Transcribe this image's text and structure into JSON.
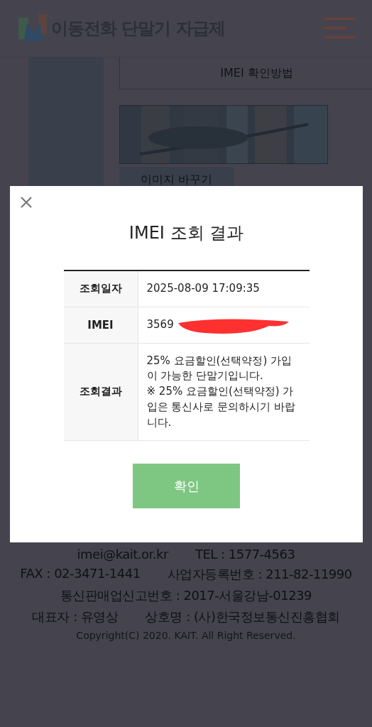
{
  "header": {
    "title": "이동전화 단말기 자급제"
  },
  "tab": {
    "label": "IMEI 확인방법"
  },
  "captcha": {
    "kind": "picture",
    "refresh_button": "이미지 바꾸기"
  },
  "modal": {
    "title": "IMEI 조회 결과",
    "rows": [
      {
        "label": "조회일자",
        "value": "2025-08-09 17:09:35",
        "redacted": false
      },
      {
        "label": "IMEI",
        "value": "3569",
        "redacted": true
      },
      {
        "label": "조회결과",
        "value": "25% 요금할인(선택약정) 가입이 가능한 단말기입니다.\n※ 25% 요금할인(선택약정) 가입은 통신사로 문의하시기 바랍니다.",
        "redacted": false
      }
    ],
    "confirm_button": "확인"
  },
  "footer": {
    "items": [
      "imei@kait.or.kr",
      "TEL : 1577-4563",
      "FAX : 02-3471-1441",
      "사업자등록번호 : 211-82-11990",
      "통신판매업신고번호 : 2017-서울강남-01239",
      "대표자 : 유영상",
      "상호명 : (사)한국정보통신진흥협회"
    ],
    "copyright": "Copyright(C) 2020. KAIT. All Right Reserved."
  }
}
